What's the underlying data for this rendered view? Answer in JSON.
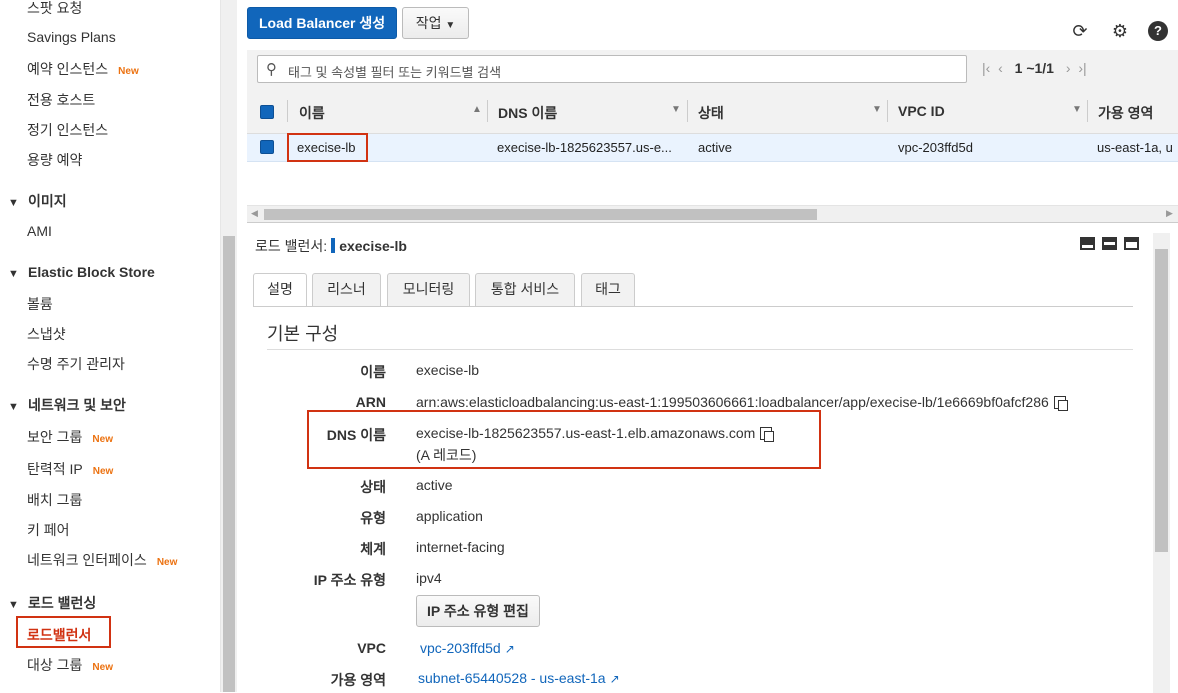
{
  "sidebar": {
    "items_top": [
      {
        "label": "스팟 요청",
        "new": ""
      },
      {
        "label": "Savings Plans",
        "new": ""
      },
      {
        "label": "예약 인스턴스",
        "new": "New"
      },
      {
        "label": "전용 호스트",
        "new": ""
      },
      {
        "label": "정기 인스턴스",
        "new": ""
      },
      {
        "label": "용량 예약",
        "new": ""
      }
    ],
    "section_images": {
      "title": "이미지",
      "items": [
        {
          "label": "AMI"
        }
      ]
    },
    "section_ebs": {
      "title": "Elastic Block Store",
      "items": [
        {
          "label": "볼륨"
        },
        {
          "label": "스냅샷"
        },
        {
          "label": "수명 주기 관리자"
        }
      ]
    },
    "section_network": {
      "title": "네트워크 및 보안",
      "items": [
        {
          "label": "보안 그룹",
          "new": "New"
        },
        {
          "label": "탄력적 IP",
          "new": "New"
        },
        {
          "label": "배치 그룹",
          "new": ""
        },
        {
          "label": "키 페어",
          "new": ""
        },
        {
          "label": "네트워크 인터페이스",
          "new": "New"
        }
      ]
    },
    "section_lb": {
      "title": "로드 밸런싱",
      "items": [
        {
          "label": "로드밸런서",
          "new": ""
        },
        {
          "label": "대상 그룹",
          "new": "New"
        }
      ]
    }
  },
  "toolbar": {
    "create_label": "Load Balancer 생성",
    "actions_label": "작업",
    "icons": [
      "refresh-icon",
      "gear-icon",
      "help-icon"
    ]
  },
  "filter": {
    "placeholder": "태그 및 속성별 필터 또는 키워드별 검색",
    "pager": "1 ~1/1"
  },
  "table": {
    "columns": [
      "이름",
      "DNS 이름",
      "상태",
      "VPC ID",
      "가용 영역"
    ],
    "rows": [
      {
        "name": "execise-lb",
        "dns": "execise-lb-1825623557.us-e...",
        "state": "active",
        "vpc": "vpc-203ffd5d",
        "az": "us-east-1a, u"
      }
    ]
  },
  "detail": {
    "title_prefix": "로드 밸런서:",
    "title_name": "execise-lb",
    "tabs": [
      "설명",
      "리스너",
      "모니터링",
      "통합 서비스",
      "태그"
    ],
    "section_title": "기본 구성",
    "fields": {
      "name_label": "이름",
      "name": "execise-lb",
      "arn_label": "ARN",
      "arn": "arn:aws:elasticloadbalancing:us-east-1:199503606661:loadbalancer/app/execise-lb/1e6669bf0afcf286",
      "dns_label": "DNS 이름",
      "dns": "execise-lb-1825623557.us-east-1.elb.amazonaws.com",
      "dns_record": "(A 레코드)",
      "state_label": "상태",
      "state": "active",
      "type_label": "유형",
      "type": "application",
      "scheme_label": "체계",
      "scheme": "internet-facing",
      "ip_label": "IP 주소 유형",
      "ip": "ipv4",
      "edit_ip_label": "IP 주소 유형 편집",
      "vpc_label": "VPC",
      "vpc": "vpc-203ffd5d",
      "az_label": "가용 영역",
      "az": "subnet-65440528 - us-east-1a"
    }
  }
}
